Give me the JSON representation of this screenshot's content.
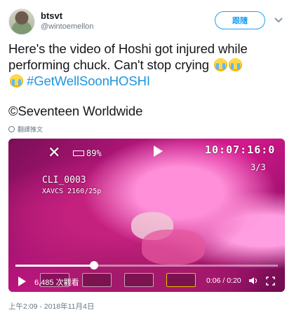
{
  "user": {
    "name": "btsvt",
    "handle": "@wintoemellon",
    "follow_label": "跟隨"
  },
  "tweet": {
    "line1": "Here's the video of Hoshi got injured while",
    "line2": "performing chuck. Can't stop crying",
    "hashtag": "#GetWellSoonHOSHI",
    "credit": "©Seventeen Worldwide",
    "translate_label": "翻譯推文",
    "emoji_icon": "loudly-crying-face-icon"
  },
  "video": {
    "osd_battery": "89%",
    "osd_time": "10:07:16:0",
    "osd_page": "3/3",
    "osd_clip": "CLI_0003",
    "osd_format": "XAVCS 2160/25p",
    "views": "6,485 次觀看",
    "time": "0:06 / 0:20",
    "progress": 0.3
  },
  "timestamp": "上午2:09 - 2018年11月4日",
  "colors": {
    "link": "#1b95e0",
    "follow_border": "#1da1f2",
    "muted": "#657786"
  }
}
